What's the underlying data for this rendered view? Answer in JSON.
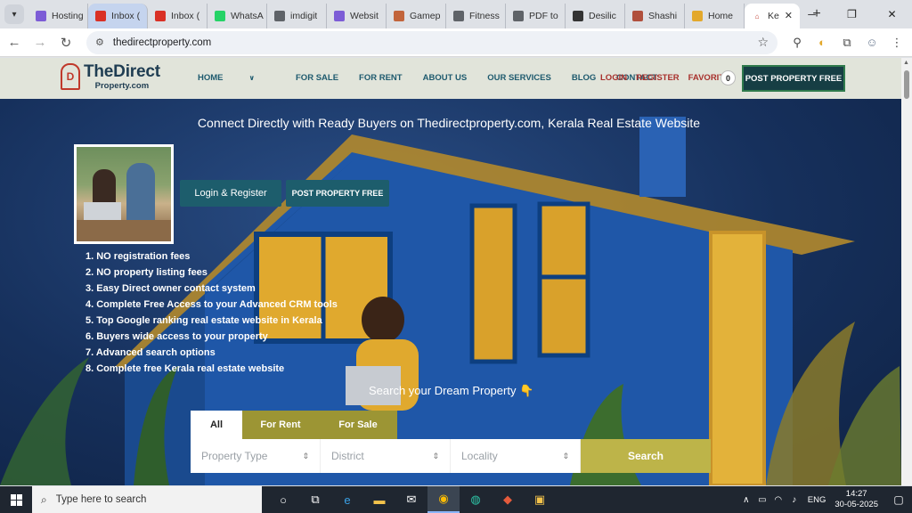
{
  "browser": {
    "tabs": [
      {
        "label": "Hosting",
        "icon": "m-logo-icon",
        "color": "#7c5cd6"
      },
      {
        "label": "Inbox (",
        "icon": "gmail-icon",
        "color": "#d93025",
        "highlight": true
      },
      {
        "label": "Inbox (",
        "icon": "gmail-icon",
        "color": "#d93025"
      },
      {
        "label": "WhatsA",
        "icon": "whatsapp-icon",
        "color": "#25d366"
      },
      {
        "label": "imdigit",
        "icon": "globe-icon",
        "color": "#5f6368"
      },
      {
        "label": "Websit",
        "icon": "m-logo-icon",
        "color": "#7c5cd6"
      },
      {
        "label": "Gamep",
        "icon": "grid-icon",
        "color": "#c2643b"
      },
      {
        "label": "Fitness",
        "icon": "globe-icon",
        "color": "#5f6368"
      },
      {
        "label": "PDF to",
        "icon": "globe-icon",
        "color": "#5f6368"
      },
      {
        "label": "Desilic",
        "icon": "record-icon",
        "color": "#333333"
      },
      {
        "label": "Shashi",
        "icon": "site-icon",
        "color": "#b04f3c"
      },
      {
        "label": "Home",
        "icon": "smile-icon",
        "color": "#e3a82b"
      }
    ],
    "active_tab": {
      "label": "Ke"
    },
    "url": "thedirectproperty.com"
  },
  "site": {
    "logo_main": "TheDirect",
    "logo_sub": "Property.com",
    "nav": [
      "HOME",
      "FOR SALE",
      "FOR RENT",
      "ABOUT US",
      "OUR SERVICES",
      "BLOG",
      "CONTACT"
    ],
    "login": "LOGIN",
    "register": "REGISTER",
    "favorites": "FAVORITES",
    "favorites_count": "0",
    "post_button": "POST PROPERTY FREE"
  },
  "hero": {
    "tagline": "Connect Directly with Ready Buyers on Thedirectproperty.com, Kerala Real Estate Website",
    "login_register": "Login & Register",
    "post_free": "POST PROPERTY FREE",
    "features": [
      "1. NO registration fees",
      "2. NO property listing fees",
      "3. Easy Direct owner contact system",
      "4. Complete Free Access to your Advanced CRM tools",
      "5. Top Google ranking real estate website in Kerala",
      "6. Buyers wide access to your property",
      "7. Advanced search options",
      "8. Complete free Kerala real estate website"
    ],
    "dream": "Search your Dream Property 👇",
    "tabs": [
      "All",
      "For Rent",
      "For Sale"
    ],
    "selects": [
      "Property Type",
      "District",
      "Locality"
    ],
    "search_button": "Search"
  },
  "taskbar": {
    "search_placeholder": "Type here to search",
    "lang": "ENG",
    "time": "14:27",
    "date": "30-05-2025"
  }
}
